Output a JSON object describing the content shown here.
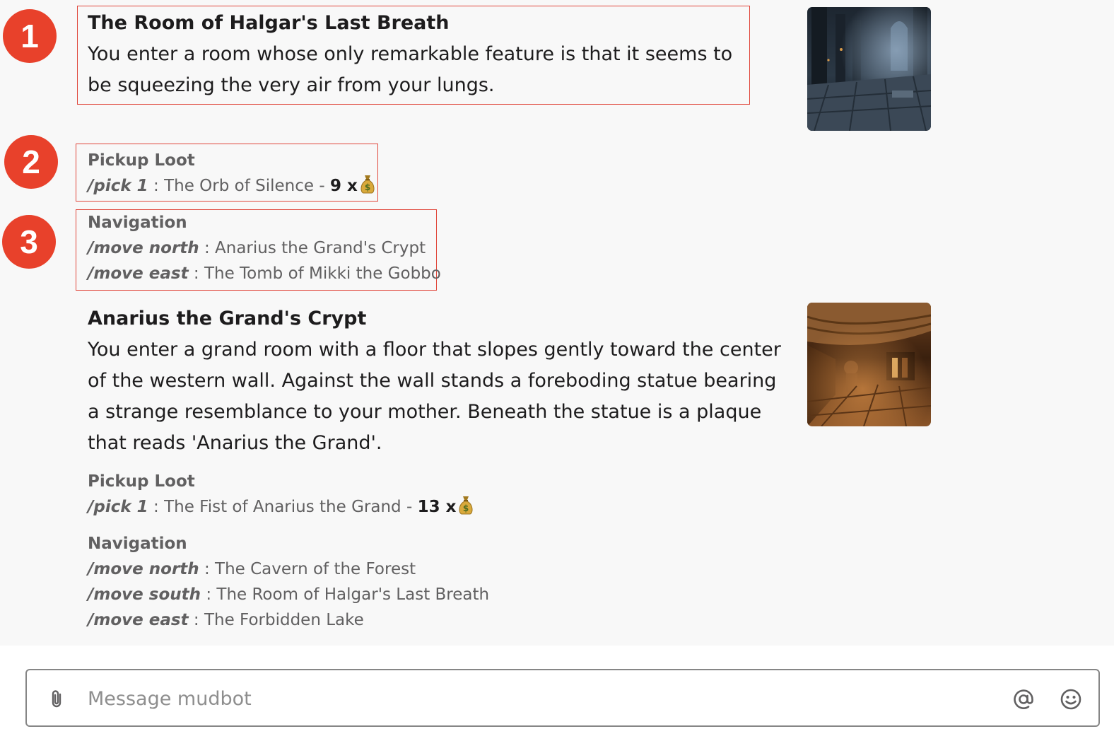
{
  "markers": [
    "1",
    "2",
    "3"
  ],
  "room1": {
    "title": "The Room of Halgar's Last Breath",
    "description": "You enter a room whose only remarkable feature is that it seems to be squeezing the very air from your lungs.",
    "image_icon": "dark-gothic-hall-image"
  },
  "loot1": {
    "heading": "Pickup Loot",
    "command": "/pick 1",
    "separator": " : ",
    "item": "The Orb of Silence - ",
    "amount": "9 x",
    "currency_icon": "money-bag-icon"
  },
  "nav1": {
    "heading": "Navigation",
    "items": [
      {
        "command": "/move north",
        "separator": " : ",
        "destination": "Anarius the Grand's Crypt"
      },
      {
        "command": "/move east",
        "separator": " : ",
        "destination": "The Tomb of Mikki the Gobbo"
      }
    ]
  },
  "room2": {
    "title": "Anarius the Grand's Crypt",
    "description": "You enter a grand room with a floor that slopes gently toward the center of the western wall.  Against the wall stands a foreboding statue bearing a strange resemblance to your mother.  Beneath the statue is a plaque that reads 'Anarius the Grand'.",
    "image_icon": "stone-crypt-image"
  },
  "loot2": {
    "heading": "Pickup Loot",
    "command": "/pick 1",
    "separator": " : ",
    "item": "The Fist of Anarius the Grand - ",
    "amount": "13 x",
    "currency_icon": "money-bag-icon"
  },
  "nav2": {
    "heading": "Navigation",
    "items": [
      {
        "command": "/move north",
        "separator": " : ",
        "destination": "The Cavern of the Forest"
      },
      {
        "command": "/move south",
        "separator": " : ",
        "destination": "The Room of Halgar's Last Breath"
      },
      {
        "command": "/move east",
        "separator": " : ",
        "destination": "The Forbidden Lake"
      }
    ]
  },
  "composer": {
    "placeholder": "Message mudbot",
    "attach_icon": "paperclip-icon",
    "mention_icon": "at-sign-icon",
    "emoji_icon": "smiley-icon"
  },
  "colors": {
    "marker": "#e8412b",
    "callout_border": "#e0463a",
    "feed_background": "#f8f8f8",
    "muted_text": "#616061"
  }
}
